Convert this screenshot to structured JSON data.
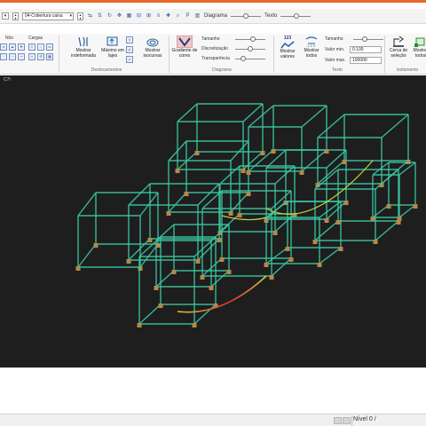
{
  "toolbar": {
    "floor_combo_value": "04-Cobertura caixa",
    "diagram_label": "Diagrama",
    "text_label": "Texto",
    "diagram_slider_value": 0.5,
    "text_slider_value": 0.55
  },
  "ribbon": {
    "nodes_label": "Nós",
    "loads_label": "Cargas",
    "show_undeformed_label": "Mostrar indeformada",
    "max_on_slabs_label": "Máximo em lajes",
    "show_isocurves_label": "Mostrar isocurvas",
    "color_gradient_label": "Gradiente de cores",
    "size_label": "Tamanho",
    "discretization_label": "Discretização",
    "transparency_label": "Transparência",
    "show_values_label": "Mostrar valores",
    "show_all_label": "Mostrar todos",
    "text_size_label": "Tamanho",
    "min_value_label": "Valor min.",
    "min_value": "0.100",
    "max_value_label": "Valor max.",
    "max_value": "100000",
    "fence_selection_label": "Cerca de seleção",
    "show_all_iso_label": "Mostrar todos",
    "group_displacements": "Deslocamentos",
    "group_diagram": "Diagrama",
    "group_text": "Texto",
    "group_isolation": "Isolamento",
    "values_icon_text": "123",
    "size_slider_value": 0.6,
    "discretization_slider_value": 0.5,
    "transparency_slider_value": 0.2
  },
  "viewport": {
    "label": "C7I",
    "frame_color": "#39c9a3",
    "support_color": "#b8864b",
    "deformed_low_color": "#c8d23c",
    "deformed_high_color": "#e0302a"
  },
  "statusbar": {
    "level_text": "Nível 0 /"
  },
  "icons": {
    "show_undeformed": "beam-deflection-icon",
    "max_on_slabs": "slab-max-icon",
    "isocurves": "isocurve-icon",
    "gradient": "color-gradient-icon",
    "show_values": "values-chart-icon",
    "show_all": "show-all-icon",
    "fence_selection": "fence-select-icon"
  }
}
